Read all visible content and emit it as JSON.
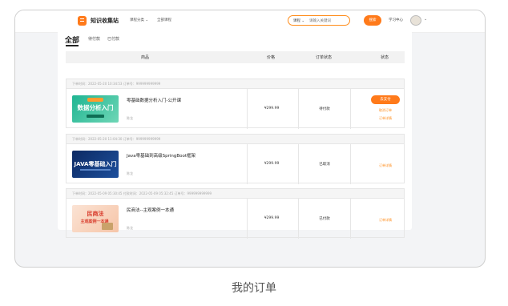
{
  "header": {
    "brand": "知识收集站",
    "nav": [
      "课程分类 ⌄",
      "全部课程"
    ],
    "search_category": "课程 ⌄",
    "search_placeholder": "请输入关键词",
    "search_button": "搜索",
    "learning_center": "学习中心",
    "avatar_caret": "⌄"
  },
  "tabs": [
    "全部",
    "待付款",
    "已付款"
  ],
  "table_headers": [
    "商品",
    "价格",
    "订单状态",
    "状态"
  ],
  "orders": [
    {
      "meta": "下单时间：2022-05-20 10:34:53    订单号：999999999999",
      "thumb_big": "数据分析入门",
      "name": "零基础数据分析入门-公开课",
      "teacher": "陈龙",
      "price": "¥299.99",
      "status": "待付款",
      "actions": [
        "去支付",
        "取消订单",
        "订单详情"
      ]
    },
    {
      "meta": "下单时间：2022-05-20 11:04:30    订单号：999999999999",
      "thumb_big": "JAVA零基础入门",
      "name": "Java零基础到高级SpringBoot框架",
      "teacher": "陈龙",
      "price": "¥299.99",
      "status": "已取消",
      "actions": [
        "订单详情"
      ]
    },
    {
      "meta": "下单时间：2022-05-09 05:30:45    付款时间：2022-05-09 05:32:45    订单号：999999999999",
      "thumb_big": "民商法",
      "thumb_sub": "主观案例一本通",
      "name": "民商法--主观案例一本通",
      "teacher": "陈龙",
      "price": "¥299.99",
      "status": "已付款",
      "actions": [
        "订单详情"
      ]
    }
  ],
  "caption": "我的订单"
}
